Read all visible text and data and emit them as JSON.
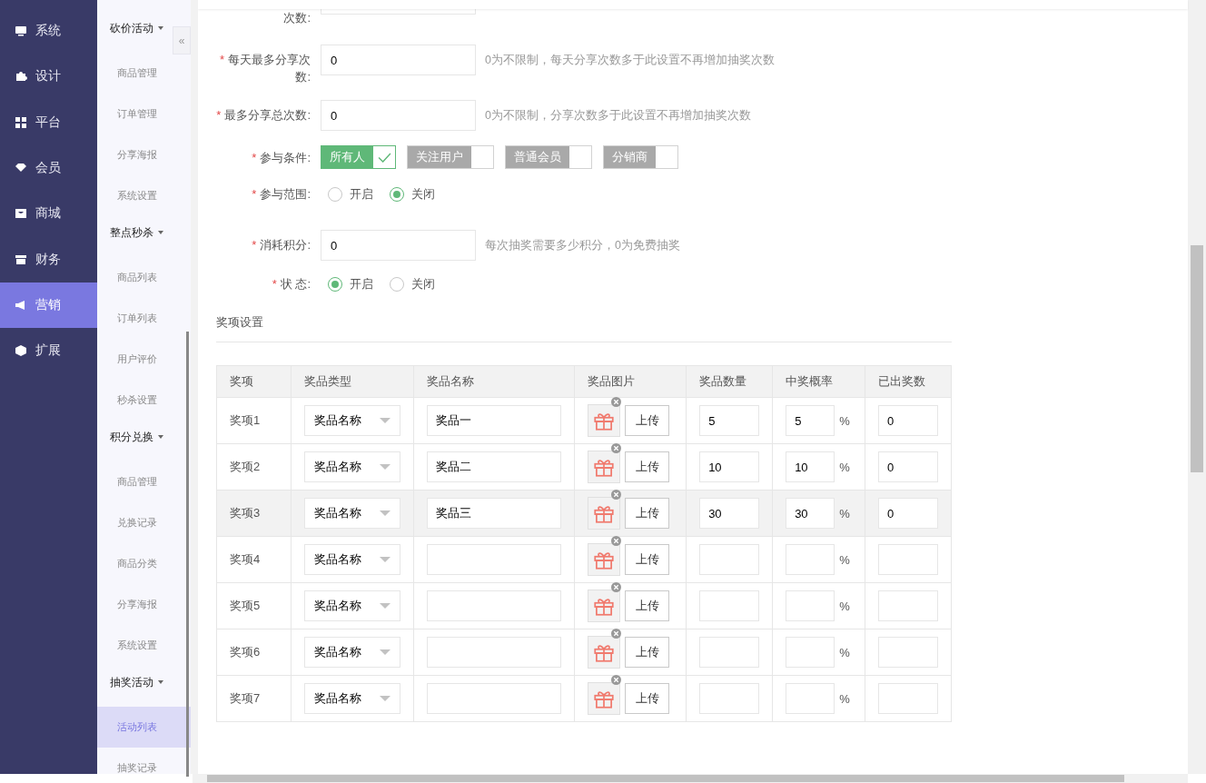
{
  "nav": [
    {
      "label": "系统",
      "selected": false
    },
    {
      "label": "设计",
      "selected": false
    },
    {
      "label": "平台",
      "selected": false
    },
    {
      "label": "会员",
      "selected": false
    },
    {
      "label": "商城",
      "selected": false
    },
    {
      "label": "财务",
      "selected": false
    },
    {
      "label": "营销",
      "selected": true
    },
    {
      "label": "扩展",
      "selected": false
    }
  ],
  "subnav": [
    {
      "title": "砍价活动",
      "expanded": true,
      "items": [
        {
          "label": "商品管理",
          "selected": false
        },
        {
          "label": "订单管理",
          "selected": false
        },
        {
          "label": "分享海报",
          "selected": false
        },
        {
          "label": "系统设置",
          "selected": false
        }
      ]
    },
    {
      "title": "整点秒杀",
      "expanded": true,
      "items": [
        {
          "label": "商品列表",
          "selected": false
        },
        {
          "label": "订单列表",
          "selected": false
        },
        {
          "label": "用户评价",
          "selected": false
        },
        {
          "label": "秒杀设置",
          "selected": false
        }
      ]
    },
    {
      "title": "积分兑换",
      "expanded": true,
      "items": [
        {
          "label": "商品管理",
          "selected": false
        },
        {
          "label": "兑换记录",
          "selected": false
        },
        {
          "label": "商品分类",
          "selected": false
        },
        {
          "label": "分享海报",
          "selected": false
        },
        {
          "label": "系统设置",
          "selected": false
        }
      ]
    },
    {
      "title": "抽奖活动",
      "expanded": true,
      "items": [
        {
          "label": "活动列表",
          "selected": true
        },
        {
          "label": "抽奖记录",
          "selected": false
        }
      ]
    }
  ],
  "collapse_button": "«",
  "form": [
    {
      "kind": "cut",
      "label": "次数:"
    },
    {
      "kind": "input",
      "mark": "*",
      "label": "每天最多分享次数:",
      "value": "0",
      "hint": "0为不限制，每天分享次数多于此设置不再增加抽奖次数"
    },
    {
      "kind": "input",
      "mark": "*",
      "label": "最多分享总次数:",
      "value": "0",
      "hint": "0为不限制，分享次数多于此设置不再增加抽奖次数"
    },
    {
      "kind": "tags",
      "mark": "*",
      "label": "参与条件:",
      "options": [
        {
          "label": "所有人",
          "checked": true
        },
        {
          "label": "关注用户",
          "checked": false
        },
        {
          "label": "普通会员",
          "checked": false
        },
        {
          "label": "分销商",
          "checked": false
        }
      ]
    },
    {
      "kind": "radio",
      "mark": "*",
      "label": "参与范围:",
      "options": [
        {
          "label": "开启",
          "selected": false
        },
        {
          "label": "关闭",
          "selected": true
        }
      ]
    },
    {
      "kind": "input",
      "mark": "*",
      "label": "消耗积分:",
      "value": "0",
      "hint": "每次抽奖需要多少积分，0为免费抽奖"
    },
    {
      "kind": "radio",
      "mark": "*",
      "label": "状 态:",
      "options": [
        {
          "label": "开启",
          "selected": true
        },
        {
          "label": "关闭",
          "selected": false
        }
      ]
    }
  ],
  "section_title": "奖项设置",
  "table": {
    "columns": [
      "奖项",
      "奖品类型",
      "奖品名称",
      "奖品图片",
      "奖品数量",
      "中奖概率",
      "已出奖数"
    ],
    "rows": [
      {
        "item": "奖项1",
        "type": "奖品名称",
        "name": "奖品一",
        "upload": "上传",
        "count": "5",
        "rate": "5",
        "percent": "%",
        "issued": "0",
        "highlighted": false
      },
      {
        "item": "奖项2",
        "type": "奖品名称",
        "name": "奖品二",
        "upload": "上传",
        "count": "10",
        "rate": "10",
        "percent": "%",
        "issued": "0",
        "highlighted": false
      },
      {
        "item": "奖项3",
        "type": "奖品名称",
        "name": "奖品三",
        "upload": "上传",
        "count": "30",
        "rate": "30",
        "percent": "%",
        "issued": "0",
        "highlighted": true
      },
      {
        "item": "奖项4",
        "type": "奖品名称",
        "upload": "上传",
        "percent": "%",
        "highlighted": false
      },
      {
        "item": "奖项5",
        "type": "奖品名称",
        "upload": "上传",
        "percent": "%",
        "highlighted": false
      },
      {
        "item": "奖项6",
        "type": "奖品名称",
        "upload": "上传",
        "percent": "%",
        "highlighted": false
      },
      {
        "item": "奖项7",
        "type": "奖品名称",
        "upload": "上传",
        "percent": "%",
        "highlighted": false
      }
    ]
  }
}
